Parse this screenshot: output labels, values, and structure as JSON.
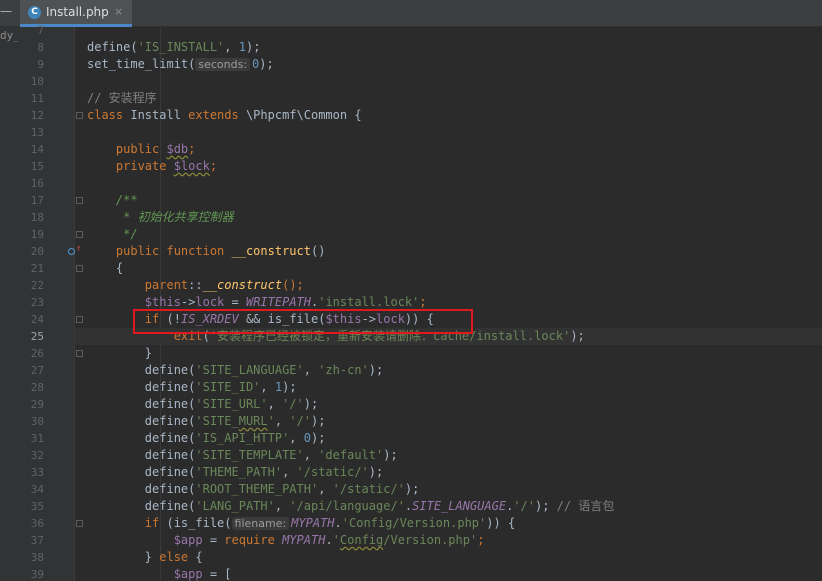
{
  "tab": {
    "icon_letter": "C",
    "filename": "Install.php",
    "close_glyph": "×"
  },
  "left_strip_text": "dy_",
  "current_line": 25,
  "lines": [
    {
      "num": 7,
      "tokens": []
    },
    {
      "num": 8,
      "tokens": [
        {
          "c": "t-id",
          "t": "define("
        },
        {
          "c": "t-str",
          "t": "'IS_INSTALL'"
        },
        {
          "c": "t-op",
          "t": ", "
        },
        {
          "c": "t-num",
          "t": "1"
        },
        {
          "c": "t-op",
          "t": ");"
        }
      ]
    },
    {
      "num": 9,
      "tokens": [
        {
          "c": "t-id",
          "t": "set_time_limit("
        },
        {
          "c": "t-hint",
          "t": "seconds:"
        },
        {
          "c": "t-num",
          "t": "0"
        },
        {
          "c": "t-op",
          "t": ");"
        }
      ]
    },
    {
      "num": 10,
      "tokens": []
    },
    {
      "num": 11,
      "tokens": [
        {
          "c": "t-cm",
          "t": "// 安装程序"
        }
      ]
    },
    {
      "num": 12,
      "tokens": [
        {
          "c": "t-kw",
          "t": "class "
        },
        {
          "c": "t-id",
          "t": "Install "
        },
        {
          "c": "t-kw",
          "t": "extends "
        },
        {
          "c": "t-id",
          "t": "\\Phpcmf\\Common {"
        }
      ]
    },
    {
      "num": 13,
      "tokens": []
    },
    {
      "num": 14,
      "tokens": [
        {
          "c": "t-kw",
          "t": "    public "
        },
        {
          "c": "t-var squiggle",
          "t": "$db"
        },
        {
          "c": "t-kw",
          "t": ";"
        }
      ]
    },
    {
      "num": 15,
      "tokens": [
        {
          "c": "t-kw",
          "t": "    private "
        },
        {
          "c": "t-var squiggle",
          "t": "$lock"
        },
        {
          "c": "t-kw",
          "t": ";"
        }
      ]
    },
    {
      "num": 16,
      "tokens": []
    },
    {
      "num": 17,
      "tokens": [
        {
          "c": "t-doc",
          "t": "    /**"
        }
      ]
    },
    {
      "num": 18,
      "tokens": [
        {
          "c": "t-doc",
          "t": "     * 初始化共享控制器"
        }
      ]
    },
    {
      "num": 19,
      "tokens": [
        {
          "c": "t-doc",
          "t": "     */"
        }
      ]
    },
    {
      "num": 20,
      "tokens": [
        {
          "c": "t-kw",
          "t": "    public function "
        },
        {
          "c": "t-fn",
          "t": "__construct"
        },
        {
          "c": "t-op",
          "t": "()"
        }
      ]
    },
    {
      "num": 21,
      "tokens": [
        {
          "c": "t-op",
          "t": "    {"
        }
      ]
    },
    {
      "num": 22,
      "tokens": [
        {
          "c": "t-kw",
          "t": "        parent"
        },
        {
          "c": "t-op",
          "t": "::"
        },
        {
          "c": "t-fni",
          "t": "__construct"
        },
        {
          "c": "t-kw",
          "t": "();"
        }
      ]
    },
    {
      "num": 23,
      "tokens": [
        {
          "c": "t-var",
          "t": "        $this"
        },
        {
          "c": "t-op",
          "t": "->"
        },
        {
          "c": "t-var",
          "t": "lock"
        },
        {
          "c": "t-op",
          "t": " = "
        },
        {
          "c": "t-const",
          "t": "WRITEPATH"
        },
        {
          "c": "t-op",
          "t": "."
        },
        {
          "c": "t-str",
          "t": "'install.lock'"
        },
        {
          "c": "t-kw",
          "t": ";"
        }
      ]
    },
    {
      "num": 24,
      "tokens": [
        {
          "c": "t-kw",
          "t": "        if "
        },
        {
          "c": "t-op",
          "t": "(!"
        },
        {
          "c": "t-const",
          "t": "IS_XRDEV"
        },
        {
          "c": "t-op",
          "t": " && "
        },
        {
          "c": "t-id",
          "t": "is_file("
        },
        {
          "c": "t-var",
          "t": "$this"
        },
        {
          "c": "t-op",
          "t": "->"
        },
        {
          "c": "t-var",
          "t": "lock"
        },
        {
          "c": "t-op",
          "t": ")) {"
        }
      ]
    },
    {
      "num": 25,
      "tokens": [
        {
          "c": "t-kw",
          "t": "            exit"
        },
        {
          "c": "t-op",
          "t": "("
        },
        {
          "c": "t-str",
          "t": "'安装程序已经被锁定，重新安装请删除：cache/install.lock'"
        },
        {
          "c": "t-op",
          "t": ");"
        }
      ]
    },
    {
      "num": 26,
      "tokens": [
        {
          "c": "t-op",
          "t": "        }"
        }
      ]
    },
    {
      "num": 27,
      "tokens": [
        {
          "c": "t-id",
          "t": "        define("
        },
        {
          "c": "t-str",
          "t": "'SITE_LANGUAGE'"
        },
        {
          "c": "t-op",
          "t": ", "
        },
        {
          "c": "t-str",
          "t": "'zh-cn'"
        },
        {
          "c": "t-op",
          "t": ");"
        }
      ]
    },
    {
      "num": 28,
      "tokens": [
        {
          "c": "t-id",
          "t": "        define("
        },
        {
          "c": "t-str",
          "t": "'SITE_ID'"
        },
        {
          "c": "t-op",
          "t": ", "
        },
        {
          "c": "t-num",
          "t": "1"
        },
        {
          "c": "t-op",
          "t": ");"
        }
      ]
    },
    {
      "num": 29,
      "tokens": [
        {
          "c": "t-id",
          "t": "        define("
        },
        {
          "c": "t-str",
          "t": "'SITE_URL'"
        },
        {
          "c": "t-op",
          "t": ", "
        },
        {
          "c": "t-str",
          "t": "'/'"
        },
        {
          "c": "t-op",
          "t": ");"
        }
      ]
    },
    {
      "num": 30,
      "tokens": [
        {
          "c": "t-id",
          "t": "        define("
        },
        {
          "c": "t-str",
          "t": "'SITE_"
        },
        {
          "c": "t-str squiggle",
          "t": "MURL"
        },
        {
          "c": "t-str",
          "t": "'"
        },
        {
          "c": "t-op",
          "t": ", "
        },
        {
          "c": "t-str",
          "t": "'/'"
        },
        {
          "c": "t-op",
          "t": ");"
        }
      ]
    },
    {
      "num": 31,
      "tokens": [
        {
          "c": "t-id",
          "t": "        define("
        },
        {
          "c": "t-str",
          "t": "'IS_API_HTTP'"
        },
        {
          "c": "t-op",
          "t": ", "
        },
        {
          "c": "t-num",
          "t": "0"
        },
        {
          "c": "t-op",
          "t": ");"
        }
      ]
    },
    {
      "num": 32,
      "tokens": [
        {
          "c": "t-id",
          "t": "        define("
        },
        {
          "c": "t-str",
          "t": "'SITE_TEMPLATE'"
        },
        {
          "c": "t-op",
          "t": ", "
        },
        {
          "c": "t-str",
          "t": "'default'"
        },
        {
          "c": "t-op",
          "t": ");"
        }
      ]
    },
    {
      "num": 33,
      "tokens": [
        {
          "c": "t-id",
          "t": "        define("
        },
        {
          "c": "t-str",
          "t": "'THEME_PATH'"
        },
        {
          "c": "t-op",
          "t": ", "
        },
        {
          "c": "t-str",
          "t": "'/static/'"
        },
        {
          "c": "t-op",
          "t": ");"
        }
      ]
    },
    {
      "num": 34,
      "tokens": [
        {
          "c": "t-id",
          "t": "        define("
        },
        {
          "c": "t-str",
          "t": "'ROOT_THEME_PATH'"
        },
        {
          "c": "t-op",
          "t": ", "
        },
        {
          "c": "t-str",
          "t": "'/static/'"
        },
        {
          "c": "t-op",
          "t": ");"
        }
      ]
    },
    {
      "num": 35,
      "tokens": [
        {
          "c": "t-id",
          "t": "        define("
        },
        {
          "c": "t-str",
          "t": "'LANG_PATH'"
        },
        {
          "c": "t-op",
          "t": ", "
        },
        {
          "c": "t-str",
          "t": "'/api/language/'"
        },
        {
          "c": "t-op",
          "t": "."
        },
        {
          "c": "t-const",
          "t": "SITE_LANGUAGE"
        },
        {
          "c": "t-op",
          "t": "."
        },
        {
          "c": "t-str",
          "t": "'/'"
        },
        {
          "c": "t-op",
          "t": "); "
        },
        {
          "c": "t-cm",
          "t": "// 语言包"
        }
      ]
    },
    {
      "num": 36,
      "tokens": [
        {
          "c": "t-kw",
          "t": "        if "
        },
        {
          "c": "t-id",
          "t": "(is_file("
        },
        {
          "c": "t-hint",
          "t": "filename:"
        },
        {
          "c": "t-const",
          "t": "MYPATH"
        },
        {
          "c": "t-op",
          "t": "."
        },
        {
          "c": "t-str",
          "t": "'Config/Version.php'"
        },
        {
          "c": "t-op",
          "t": ")) {"
        }
      ]
    },
    {
      "num": 37,
      "tokens": [
        {
          "c": "t-var",
          "t": "            $app"
        },
        {
          "c": "t-op",
          "t": " = "
        },
        {
          "c": "t-kw",
          "t": "require "
        },
        {
          "c": "t-const",
          "t": "MYPATH"
        },
        {
          "c": "t-op",
          "t": "."
        },
        {
          "c": "t-str",
          "t": "'"
        },
        {
          "c": "t-str squiggle",
          "t": "Config"
        },
        {
          "c": "t-str",
          "t": "/Version.php'"
        },
        {
          "c": "t-kw",
          "t": ";"
        }
      ]
    },
    {
      "num": 38,
      "tokens": [
        {
          "c": "t-op",
          "t": "        } "
        },
        {
          "c": "t-kw",
          "t": "else "
        },
        {
          "c": "t-op",
          "t": "{"
        }
      ]
    },
    {
      "num": 39,
      "tokens": [
        {
          "c": "t-var",
          "t": "            $app"
        },
        {
          "c": "t-op",
          "t": " = ["
        }
      ]
    }
  ]
}
